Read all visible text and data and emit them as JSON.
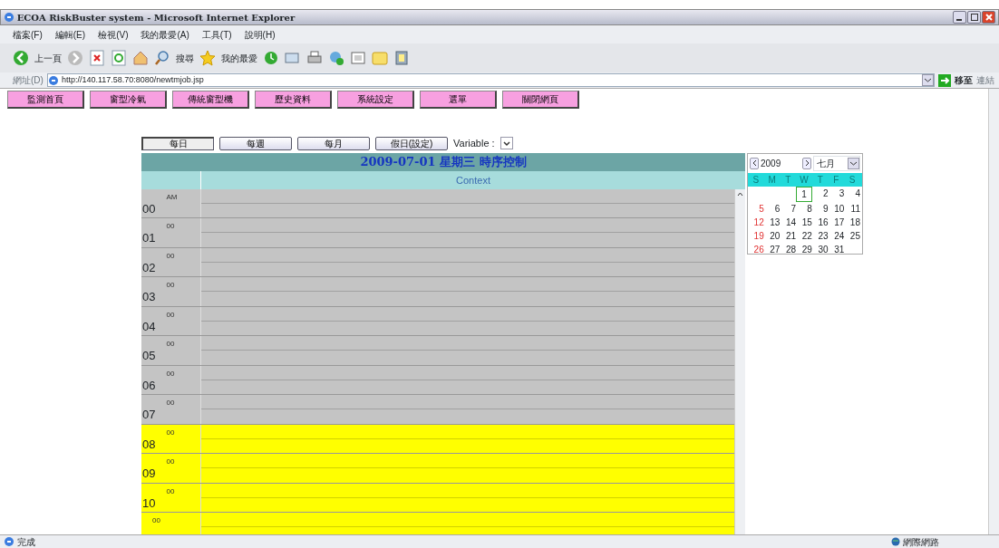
{
  "window": {
    "title": "ECOA RiskBuster system - Microsoft Internet Explorer"
  },
  "menu": [
    "檔案(F)",
    "編輯(E)",
    "檢視(V)",
    "我的最愛(A)",
    "工具(T)",
    "說明(H)"
  ],
  "toolbar": {
    "back": "上一頁",
    "search": "搜尋",
    "favorites": "我的最愛"
  },
  "address": {
    "label": "網址(D)",
    "url": "http://140.117.58.70:8080/newtmjob.jsp",
    "go": "移至",
    "links": "連結"
  },
  "nav": [
    "監測首頁",
    "窗型冷氣",
    "傳統窗型機",
    "歷史資料",
    "系統設定",
    "選單",
    "關閉網頁"
  ],
  "views": [
    {
      "label": "每日",
      "selected": true
    },
    {
      "label": "每週",
      "selected": false
    },
    {
      "label": "每月",
      "selected": false
    },
    {
      "label": "假日(設定)",
      "selected": false
    }
  ],
  "variable_label": "Variable :",
  "schedule": {
    "title": "2009-07-01 星期三 時序控制",
    "context_header": "Context",
    "rows": [
      {
        "hour": "00",
        "minute": "AM",
        "active": false
      },
      {
        "hour": "01",
        "minute": "00",
        "active": false
      },
      {
        "hour": "02",
        "minute": "00",
        "active": false
      },
      {
        "hour": "03",
        "minute": "00",
        "active": false
      },
      {
        "hour": "04",
        "minute": "00",
        "active": false
      },
      {
        "hour": "05",
        "minute": "00",
        "active": false
      },
      {
        "hour": "06",
        "minute": "00",
        "active": false
      },
      {
        "hour": "07",
        "minute": "00",
        "active": false
      },
      {
        "hour": "08",
        "minute": "00",
        "active": true
      },
      {
        "hour": "09",
        "minute": "00",
        "active": true
      },
      {
        "hour": "10",
        "minute": "00",
        "active": true
      },
      {
        "minute": "00",
        "active": true
      }
    ]
  },
  "calendar": {
    "year": "2009",
    "month": "七月",
    "weekdays": [
      "S",
      "M",
      "T",
      "W",
      "T",
      "F",
      "S"
    ],
    "weeks": [
      [
        {
          "day": "1",
          "selected": true
        },
        {
          "day": "2",
          "selected": false
        },
        {
          "day": "3",
          "selected": false
        },
        {
          "day": "4",
          "selected": false
        }
      ],
      [
        {
          "day": "5",
          "selected": false
        },
        {
          "day": "6",
          "selected": false
        },
        {
          "day": "7",
          "selected": false
        },
        {
          "day": "8",
          "selected": false
        },
        {
          "day": "9",
          "selected": false
        },
        {
          "day": "10",
          "selected": false
        },
        {
          "day": "11",
          "selected": false
        }
      ],
      [
        {
          "day": "12",
          "selected": false
        },
        {
          "day": "13",
          "selected": false
        },
        {
          "day": "14",
          "selected": false
        },
        {
          "day": "15",
          "selected": false
        },
        {
          "day": "16",
          "selected": false
        },
        {
          "day": "17",
          "selected": false
        },
        {
          "day": "18",
          "selected": false
        }
      ],
      [
        {
          "day": "19",
          "selected": false
        },
        {
          "day": "20",
          "selected": false
        },
        {
          "day": "21",
          "selected": false
        },
        {
          "day": "22",
          "selected": false
        },
        {
          "day": "23",
          "selected": false
        },
        {
          "day": "24",
          "selected": false
        },
        {
          "day": "25",
          "selected": false
        }
      ],
      [
        {
          "day": "26",
          "selected": false
        },
        {
          "day": "27",
          "selected": false
        },
        {
          "day": "28",
          "selected": false
        },
        {
          "day": "29",
          "selected": false
        },
        {
          "day": "30",
          "selected": false
        },
        {
          "day": "31",
          "selected": false
        }
      ]
    ]
  },
  "status_bar": {
    "text": "完成",
    "zone": "網際網路"
  }
}
